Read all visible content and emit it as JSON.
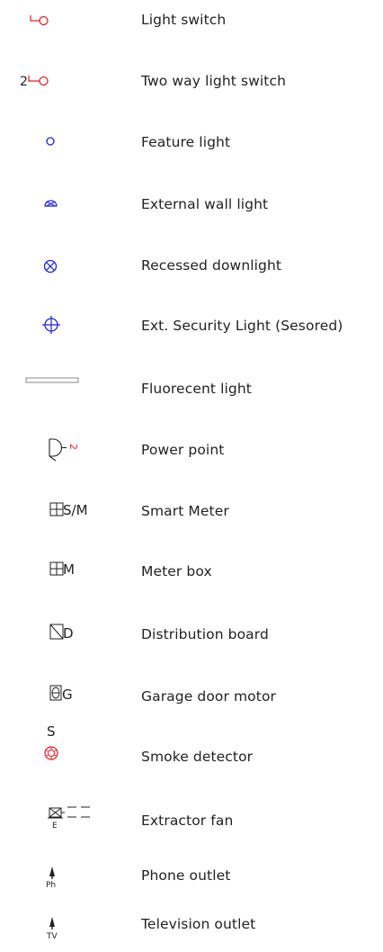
{
  "colors": {
    "red": "#e8222a",
    "blue": "#1f23e0",
    "dark": "#222222",
    "grey": "#8a8a8a"
  },
  "legend": {
    "items": [
      {
        "icon": "light-switch-icon",
        "label": "Light switch"
      },
      {
        "icon": "two-way-light-switch-icon",
        "label": "Two way light switch",
        "symbol_text": "2"
      },
      {
        "icon": "feature-light-icon",
        "label": "Feature light"
      },
      {
        "icon": "external-wall-light-icon",
        "label": "External wall light"
      },
      {
        "icon": "recessed-downlight-icon",
        "label": "Recessed downlight"
      },
      {
        "icon": "security-light-icon",
        "label": "Ext. Security Light (Sesored)"
      },
      {
        "icon": "fluorescent-light-icon",
        "label": "Fluorecent light"
      },
      {
        "icon": "power-point-icon",
        "label": "Power point",
        "symbol_text": "2"
      },
      {
        "icon": "smart-meter-icon",
        "label": "Smart Meter",
        "symbol_text": "S/M"
      },
      {
        "icon": "meter-box-icon",
        "label": "Meter box",
        "symbol_text": "M"
      },
      {
        "icon": "distribution-board-icon",
        "label": "Distribution board",
        "symbol_text": "D"
      },
      {
        "icon": "garage-door-motor-icon",
        "label": "Garage door motor",
        "symbol_text": "G"
      },
      {
        "icon": "smoke-detector-icon",
        "label": "Smoke detector",
        "symbol_text": "S"
      },
      {
        "icon": "extractor-fan-icon",
        "label": "Extractor fan",
        "symbol_text": "E"
      },
      {
        "icon": "phone-outlet-icon",
        "label": "Phone outlet",
        "symbol_text": "Ph"
      },
      {
        "icon": "television-outlet-icon",
        "label": "Television outlet",
        "symbol_text": "TV"
      }
    ]
  }
}
